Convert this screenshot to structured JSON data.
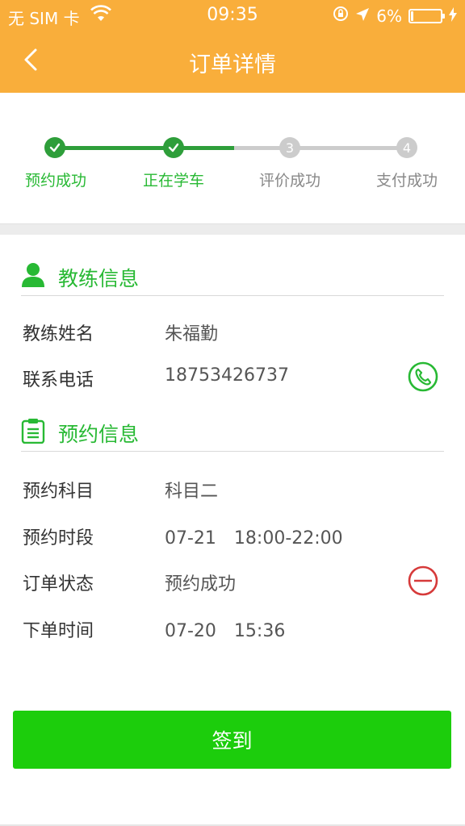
{
  "status_bar": {
    "carrier": "无 SIM 卡",
    "time": "09:35",
    "battery_text": "6%",
    "battery_level": 0.06
  },
  "nav": {
    "title": "订单详情"
  },
  "steps": [
    {
      "label": "预约成功",
      "number": "",
      "state": "done"
    },
    {
      "label": "正在学车",
      "number": "",
      "state": "done"
    },
    {
      "label": "评价成功",
      "number": "3",
      "state": "pending"
    },
    {
      "label": "支付成功",
      "number": "4",
      "state": "pending"
    }
  ],
  "coach_section": {
    "title": "教练信息",
    "rows": [
      {
        "label": "教练姓名",
        "value": "朱福勤"
      },
      {
        "label": "联系电话",
        "value": "18753426737"
      }
    ]
  },
  "booking_section": {
    "title": "预约信息",
    "rows": [
      {
        "label": "预约科目",
        "value": "科目二"
      },
      {
        "label": "预约时段",
        "value": "07-21　18:00-22:00"
      },
      {
        "label": "订单状态",
        "value": "预约成功"
      },
      {
        "label": "下单时间",
        "value": "07-20　15:36"
      }
    ]
  },
  "actions": {
    "signin_label": "签到"
  },
  "colors": {
    "header": "#f9ae3b",
    "green": "#28b934",
    "progress_done": "#2e9e3a",
    "progress_pending": "#cccccc",
    "button": "#1ccd0c",
    "cancel_red": "#d63a3a"
  },
  "icons": {
    "back": "chevron-left-icon",
    "coach": "person-icon",
    "booking": "clipboard-icon",
    "call": "phone-icon",
    "cancel": "minus-circle-icon"
  }
}
